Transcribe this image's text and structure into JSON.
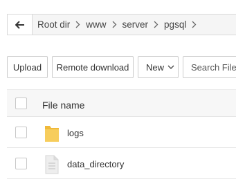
{
  "breadcrumb": {
    "back_icon": "arrow-left-icon",
    "separator_icon": "chevron-right-icon",
    "items": [
      {
        "label": "Root dir"
      },
      {
        "label": "www"
      },
      {
        "label": "server"
      },
      {
        "label": "pgsql"
      }
    ]
  },
  "toolbar": {
    "upload_label": "Upload",
    "remote_download_label": "Remote download",
    "new_label": "New",
    "new_icon": "chevron-down-icon",
    "search_placeholder": "Search Files or"
  },
  "file_list": {
    "header": {
      "name_label": "File name"
    },
    "rows": [
      {
        "name": "logs",
        "type": "folder",
        "icon": "folder-icon",
        "icon_color": "#f5c24a"
      },
      {
        "name": "data_directory",
        "type": "file",
        "icon": "document-icon",
        "icon_color": "#e6e6e6"
      }
    ]
  }
}
